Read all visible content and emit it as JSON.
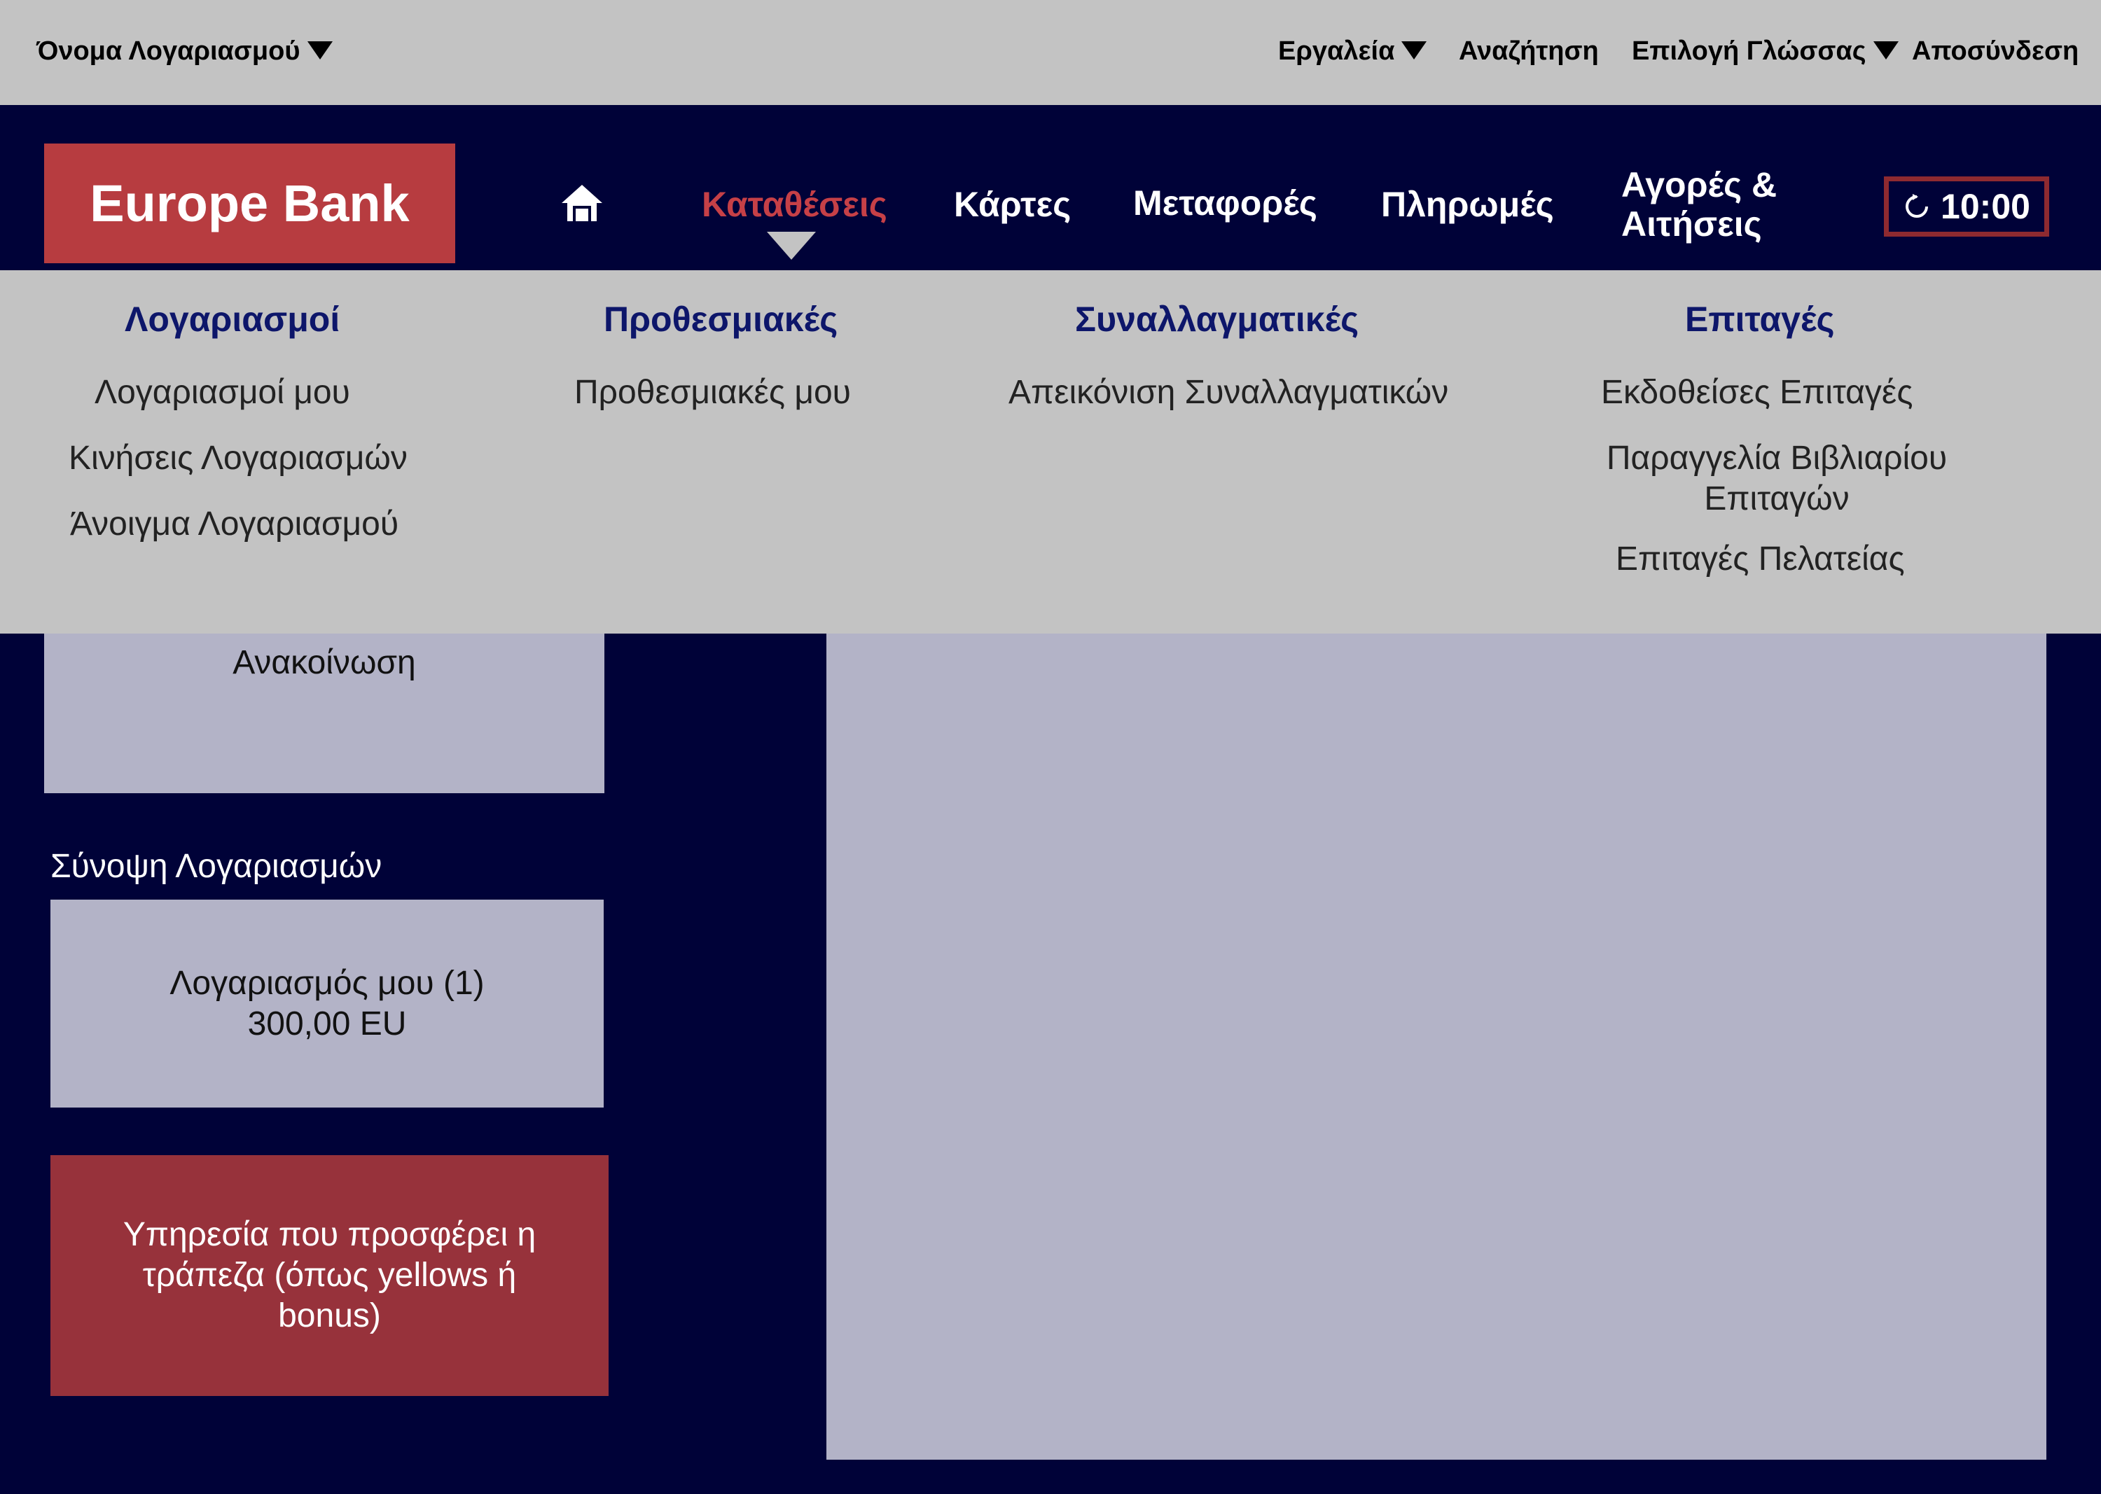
{
  "topbar": {
    "account_name": "Όνομα Λογαριασμού",
    "tools": "Εργαλεία",
    "search": "Αναζήτηση",
    "language": "Επιλογή Γλώσσας",
    "logout": "Αποσύνδεση"
  },
  "brand": {
    "name": "Europe Bank",
    "color": "#b73c40"
  },
  "nav": {
    "home_icon": "home-icon",
    "deposits": "Καταθέσεις",
    "cards": "Κάρτες",
    "transfers": "Μεταφορές",
    "payments": "Πληρωμές",
    "purchases_line1": "Αγορές &",
    "purchases_line2": "Αιτήσεις",
    "timer": "10:00",
    "timer_icon": "refresh-icon",
    "active_color": "#c64047"
  },
  "megamenu": {
    "accounts": {
      "title": "Λογαριασμοί",
      "items": [
        "Λογαριασμοί μου",
        "Κινήσεις Λογαριασμών",
        "Άνοιγμα Λογαριασμού"
      ]
    },
    "time_deposits": {
      "title": "Προθεσμιακές",
      "items": [
        "Προθεσμιακές μου"
      ]
    },
    "bills": {
      "title": "Συναλλαγματικές",
      "items": [
        "Απεικόνιση Συναλλαγματικών"
      ]
    },
    "cheques": {
      "title": "Επιταγές",
      "items": [
        "Εκδοθείσες Επιταγές",
        "Παραγγελία Βιβλιαρίου",
        "Επιταγών",
        "Επιταγές Πελατείας"
      ]
    }
  },
  "content": {
    "announcement": "Ανακοίνωση",
    "summary_title": "Σύνοψη Λογαριασμών",
    "account_name": "Λογαριασμός μου (1)",
    "account_balance": "300,00 EU",
    "promo_line1": "Υπηρεσία που προσφέρει η",
    "promo_line2": "τράπεζα (όπως yellows ή",
    "promo_line3": "bonus)"
  }
}
